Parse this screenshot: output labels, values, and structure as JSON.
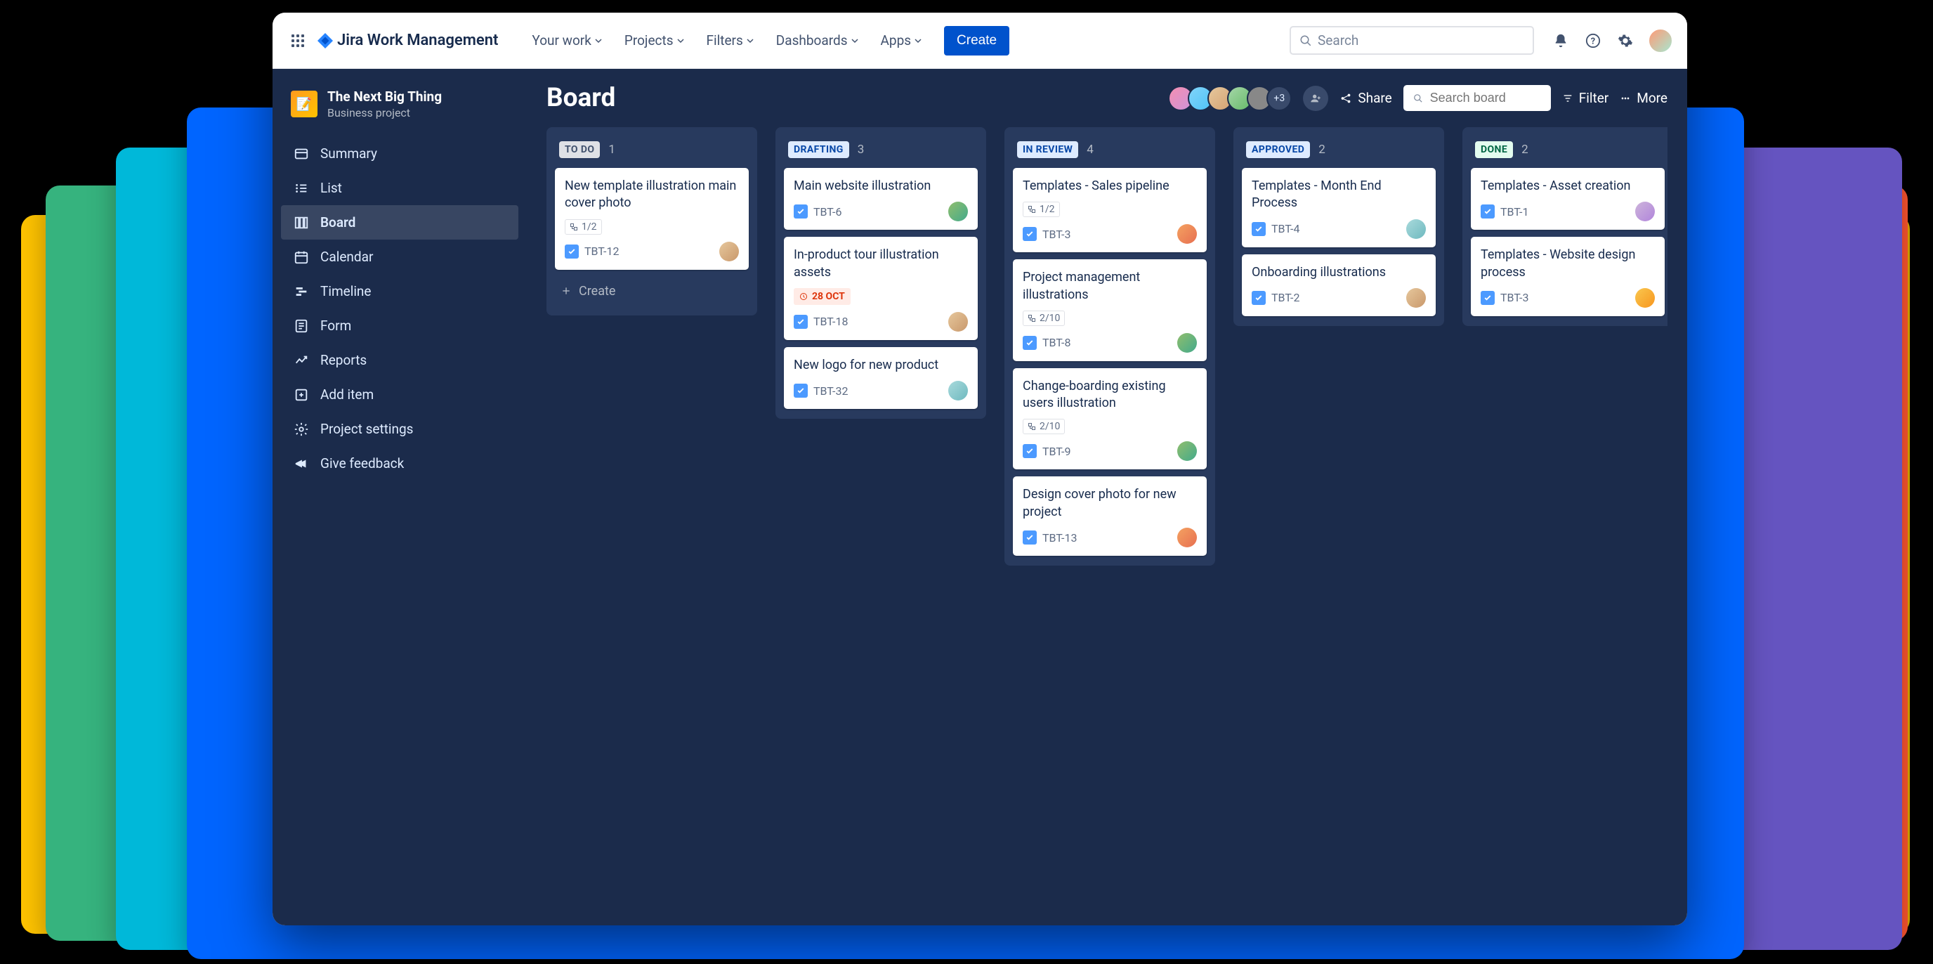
{
  "brand": "Jira Work Management",
  "nav": {
    "your_work": "Your work",
    "projects": "Projects",
    "filters": "Filters",
    "dashboards": "Dashboards",
    "apps": "Apps"
  },
  "create_label": "Create",
  "search_placeholder": "Search",
  "project": {
    "name": "The Next Big Thing",
    "type": "Business project"
  },
  "sidebar": {
    "summary": "Summary",
    "list": "List",
    "board": "Board",
    "calendar": "Calendar",
    "timeline": "Timeline",
    "form": "Form",
    "reports": "Reports",
    "add_item": "Add item",
    "project_settings": "Project settings",
    "give_feedback": "Give feedback"
  },
  "page": {
    "title": "Board",
    "avatar_overflow": "+3",
    "share": "Share",
    "search_board_placeholder": "Search board",
    "filter": "Filter",
    "more": "More"
  },
  "columns": [
    {
      "name": "TO DO",
      "count": "1",
      "style": "col-todo",
      "cards": [
        {
          "title": "New template illustration main cover photo",
          "subtask": "1/2",
          "key": "TBT-12",
          "assignee": "as1"
        }
      ],
      "show_create": true
    },
    {
      "name": "DRAFTING",
      "count": "3",
      "style": "col-drafting",
      "cards": [
        {
          "title": "Main website illustration",
          "key": "TBT-6",
          "assignee": "as5"
        },
        {
          "title": "In-product tour illustration assets",
          "due": "28 OCT",
          "key": "TBT-18",
          "assignee": "as1"
        },
        {
          "title": "New logo for new product",
          "key": "TBT-32",
          "assignee": "as2"
        }
      ]
    },
    {
      "name": "IN REVIEW",
      "count": "4",
      "style": "col-review",
      "cards": [
        {
          "title": "Templates - Sales pipeline",
          "subtask": "1/2",
          "key": "TBT-3",
          "assignee": "as4"
        },
        {
          "title": "Project management illustrations",
          "subtask": "2/10",
          "key": "TBT-8",
          "assignee": "as5"
        },
        {
          "title": "Change-boarding existing users illustration",
          "subtask": "2/10",
          "key": "TBT-9",
          "assignee": "as5"
        },
        {
          "title": "Design cover photo for new project",
          "key": "TBT-13",
          "assignee": "as4"
        }
      ]
    },
    {
      "name": "APPROVED",
      "count": "2",
      "style": "col-approved",
      "cards": [
        {
          "title": "Templates - Month End Process",
          "key": "TBT-4",
          "assignee": "as2"
        },
        {
          "title": "Onboarding illustrations",
          "key": "TBT-2",
          "assignee": "as1"
        }
      ]
    },
    {
      "name": "DONE",
      "count": "2",
      "style": "col-done",
      "cards": [
        {
          "title": "Templates - Asset creation",
          "key": "TBT-1",
          "assignee": "as3"
        },
        {
          "title": "Templates - Website design process",
          "key": "TBT-3",
          "assignee": "as6"
        }
      ]
    }
  ],
  "create_card_label": "Create"
}
